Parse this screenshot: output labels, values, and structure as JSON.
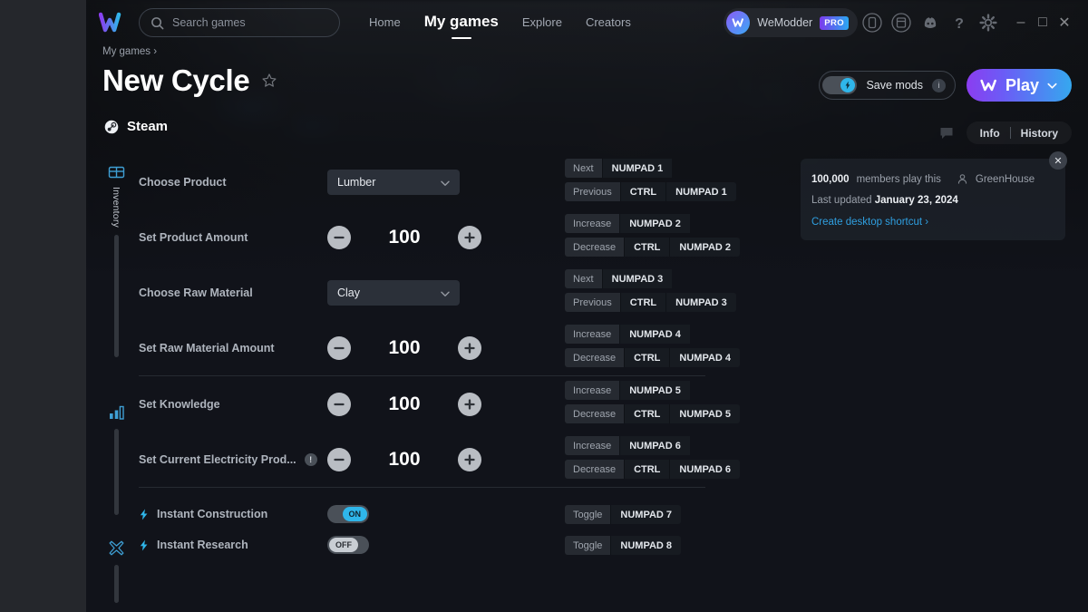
{
  "topbar": {
    "logo": "wemod-logo",
    "search": {
      "placeholder": "Search games",
      "icon": "search-icon"
    },
    "nav": [
      {
        "label": "Home",
        "active": false
      },
      {
        "label": "My games",
        "active": true
      },
      {
        "label": "Explore",
        "active": false
      },
      {
        "label": "Creators",
        "active": false
      }
    ],
    "user": {
      "name": "WeModder",
      "badge": "PRO"
    },
    "icons": [
      "phone-icon",
      "library-icon",
      "discord-icon",
      "help-icon",
      "gear-icon"
    ],
    "window_controls": {
      "minimize": "–",
      "maximize": "□",
      "close": "✕"
    }
  },
  "header": {
    "breadcrumb": "My games",
    "breadcrumb_chevron": "›",
    "title": "New Cycle",
    "favorite_icon": "star-icon",
    "platform": "Steam",
    "platform_icon": "steam-icon",
    "save_mods": {
      "label": "Save mods",
      "state": "on",
      "info": "i"
    },
    "play": {
      "label": "Play",
      "caret": "chevron-down-icon"
    },
    "tabs": [
      {
        "label": "Info"
      },
      {
        "label": "History"
      }
    ],
    "chat_icon": "chat-icon"
  },
  "info_card": {
    "members_count": "100,000",
    "members_text": "members play this",
    "creator": "GreenHouse",
    "last_updated_label": "Last updated",
    "last_updated_date": "January 23, 2024",
    "shortcut_link": "Create desktop shortcut ›",
    "close": "✕"
  },
  "categories": [
    {
      "name": "inventory",
      "icon": "chest-icon",
      "label": "Inventory",
      "track_height": 135
    },
    {
      "name": "stats",
      "icon": "bar-chart-icon",
      "label": "",
      "track_height": 95
    },
    {
      "name": "misc",
      "icon": "cross-icon",
      "label": "",
      "track_height": 42
    }
  ],
  "sections": [
    {
      "name": "inventory",
      "rows": [
        {
          "label": "Choose Product",
          "type": "select",
          "value": "Lumber",
          "hotkeys": [
            {
              "action": "Next",
              "keys": [
                "NUMPAD 1"
              ]
            },
            {
              "action": "Previous",
              "keys": [
                "CTRL",
                "NUMPAD 1"
              ]
            }
          ]
        },
        {
          "label": "Set Product Amount",
          "type": "stepper",
          "value": "100",
          "hotkeys": [
            {
              "action": "Increase",
              "keys": [
                "NUMPAD 2"
              ]
            },
            {
              "action": "Decrease",
              "keys": [
                "CTRL",
                "NUMPAD 2"
              ]
            }
          ]
        },
        {
          "label": "Choose Raw Material",
          "type": "select",
          "value": "Clay",
          "hotkeys": [
            {
              "action": "Next",
              "keys": [
                "NUMPAD 3"
              ]
            },
            {
              "action": "Previous",
              "keys": [
                "CTRL",
                "NUMPAD 3"
              ]
            }
          ]
        },
        {
          "label": "Set Raw Material Amount",
          "type": "stepper",
          "value": "100",
          "hotkeys": [
            {
              "action": "Increase",
              "keys": [
                "NUMPAD 4"
              ]
            },
            {
              "action": "Decrease",
              "keys": [
                "CTRL",
                "NUMPAD 4"
              ]
            }
          ]
        }
      ]
    },
    {
      "name": "stats",
      "rows": [
        {
          "label": "Set Knowledge",
          "type": "stepper",
          "value": "100",
          "hotkeys": [
            {
              "action": "Increase",
              "keys": [
                "NUMPAD 5"
              ]
            },
            {
              "action": "Decrease",
              "keys": [
                "CTRL",
                "NUMPAD 5"
              ]
            }
          ]
        },
        {
          "label": "Set Current Electricity Prod...",
          "type": "stepper",
          "value": "100",
          "warn": "!",
          "hotkeys": [
            {
              "action": "Increase",
              "keys": [
                "NUMPAD 6"
              ]
            },
            {
              "action": "Decrease",
              "keys": [
                "CTRL",
                "NUMPAD 6"
              ]
            }
          ]
        }
      ]
    },
    {
      "name": "misc",
      "rows": [
        {
          "label": "Instant Construction",
          "type": "toggle",
          "state": "ON",
          "bolt": true,
          "hotkeys": [
            {
              "action": "Toggle",
              "keys": [
                "NUMPAD 7"
              ]
            }
          ]
        },
        {
          "label": "Instant Research",
          "type": "toggle",
          "state": "OFF",
          "bolt": true,
          "hotkeys": [
            {
              "action": "Toggle",
              "keys": [
                "NUMPAD 8"
              ]
            }
          ]
        }
      ]
    }
  ],
  "colors": {
    "accent_cyan": "#2fb6ea",
    "accent_purple": "#8b3df0",
    "link": "#2f9fe0",
    "background": "#11131a"
  }
}
